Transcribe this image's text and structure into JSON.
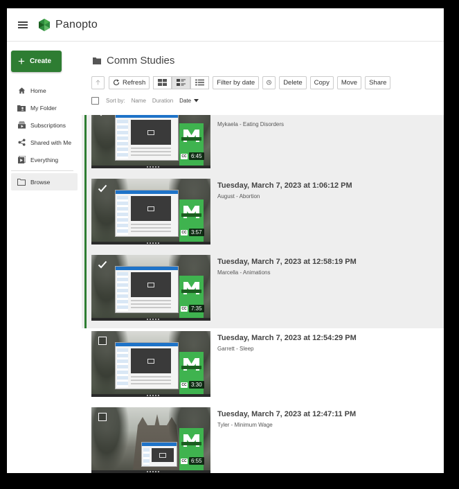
{
  "app": {
    "name": "Panopto"
  },
  "sidebar": {
    "create_label": "Create",
    "items": [
      {
        "label": "Home",
        "icon": "home-icon"
      },
      {
        "label": "My Folder",
        "icon": "user-folder-icon"
      },
      {
        "label": "Subscriptions",
        "icon": "subscriptions-icon"
      },
      {
        "label": "Shared with Me",
        "icon": "share-icon"
      },
      {
        "label": "Everything",
        "icon": "everything-icon"
      }
    ],
    "browse_label": "Browse"
  },
  "folder": {
    "title": "Comm Studies"
  },
  "toolbar": {
    "refresh_label": "Refresh",
    "filter_label": "Filter by date",
    "delete_label": "Delete",
    "copy_label": "Copy",
    "move_label": "Move",
    "share_label": "Share"
  },
  "sort": {
    "label": "Sort by:",
    "name": "Name",
    "duration": "Duration",
    "date": "Date"
  },
  "sessions": [
    {
      "title": "",
      "subtitle": "Mykaela - Eating Disorders",
      "duration": "6:45",
      "selected": true
    },
    {
      "title": "Tuesday, March 7, 2023 at 1:06:12 PM",
      "subtitle": "August - Abortion",
      "duration": "3:57",
      "selected": true
    },
    {
      "title": "Tuesday, March 7, 2023 at 12:58:19 PM",
      "subtitle": "Marcella - Animations",
      "duration": "7:35",
      "selected": true
    },
    {
      "title": "Tuesday, March 7, 2023 at 12:54:29 PM",
      "subtitle": "Garrett - Sleep",
      "duration": "3:30",
      "selected": false
    },
    {
      "title": "Tuesday, March 7, 2023 at 12:47:11 PM",
      "subtitle": "Tyler - Minimum Wage",
      "duration": "6:55",
      "selected": false
    }
  ],
  "colors": {
    "brand_green": "#2e7d32",
    "accent_green": "#3fb34f"
  }
}
